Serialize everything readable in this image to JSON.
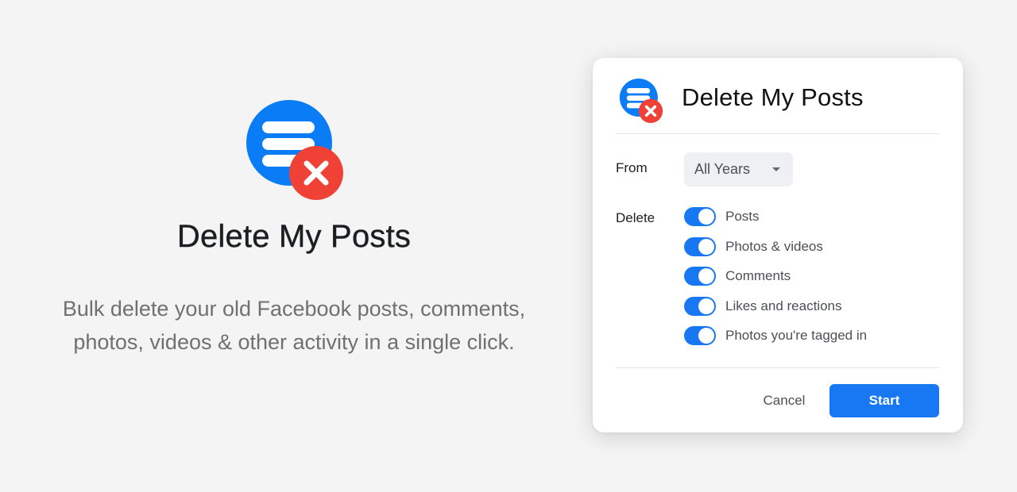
{
  "colors": {
    "brand_blue": "#1877f2",
    "logo_blue": "#0a7cf5",
    "delete_red": "#ef4136",
    "background": "#f4f4f4"
  },
  "hero": {
    "logo_icon": "list-with-delete-badge-icon",
    "title": "Delete My Posts",
    "description_line1": "Bulk delete your old Facebook posts, comments,",
    "description_line2": "photos, videos & other activity in a single click."
  },
  "dialog": {
    "logo_icon": "list-with-delete-badge-icon",
    "title": "Delete My Posts",
    "from_label": "From",
    "from_select": {
      "value": "All Years",
      "icon": "caret-down-icon"
    },
    "delete_label": "Delete",
    "options": [
      {
        "label": "Posts",
        "enabled": true
      },
      {
        "label": "Photos & videos",
        "enabled": true
      },
      {
        "label": "Comments",
        "enabled": true
      },
      {
        "label": "Likes and reactions",
        "enabled": true
      },
      {
        "label": "Photos you're tagged in",
        "enabled": true
      }
    ],
    "cancel_label": "Cancel",
    "start_label": "Start"
  }
}
